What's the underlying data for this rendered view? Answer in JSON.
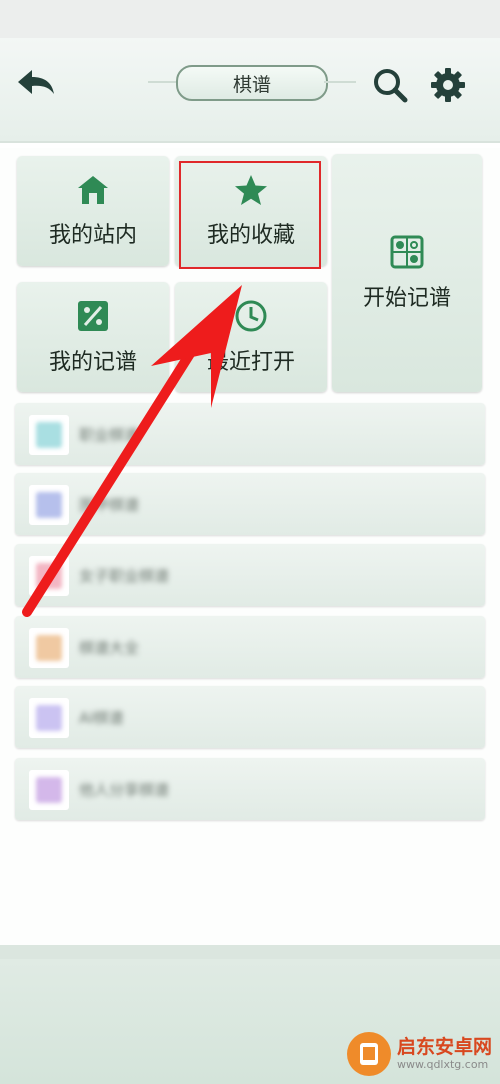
{
  "header": {
    "title": "棋谱",
    "back_icon": "back-arrow-icon",
    "search_icon": "search-icon",
    "settings_icon": "gear-icon"
  },
  "tiles": {
    "my_station": {
      "label": "我的站内",
      "icon": "home-icon"
    },
    "favorites": {
      "label": "我的收藏",
      "icon": "star-icon"
    },
    "start_record": {
      "label": "开始记谱",
      "icon": "board-icon"
    },
    "my_records": {
      "label": "我的记谱",
      "icon": "record-icon"
    },
    "recent": {
      "label": "最近打开",
      "icon": "clock-icon"
    }
  },
  "list": {
    "items": [
      {
        "label": "职业棋谱",
        "icon_color": "#a9dfe2"
      },
      {
        "label": "围甲棋谱",
        "icon_color": "#b6c0ec"
      },
      {
        "label": "女子职业棋谱",
        "icon_color": "#f3b6c3"
      },
      {
        "label": "棋谱大全",
        "icon_color": "#f0c9a2"
      },
      {
        "label": "AI棋谱",
        "icon_color": "#cbc3f2"
      },
      {
        "label": "他人分享棋谱",
        "icon_color": "#d4b8ea"
      }
    ]
  },
  "colors": {
    "accent": "#2f8a55",
    "highlight_box": "#e0282a",
    "annotation_arrow": "#ee1c1c"
  },
  "watermark": {
    "title": "启东安卓网",
    "url": "www.qdlxtg.com"
  }
}
